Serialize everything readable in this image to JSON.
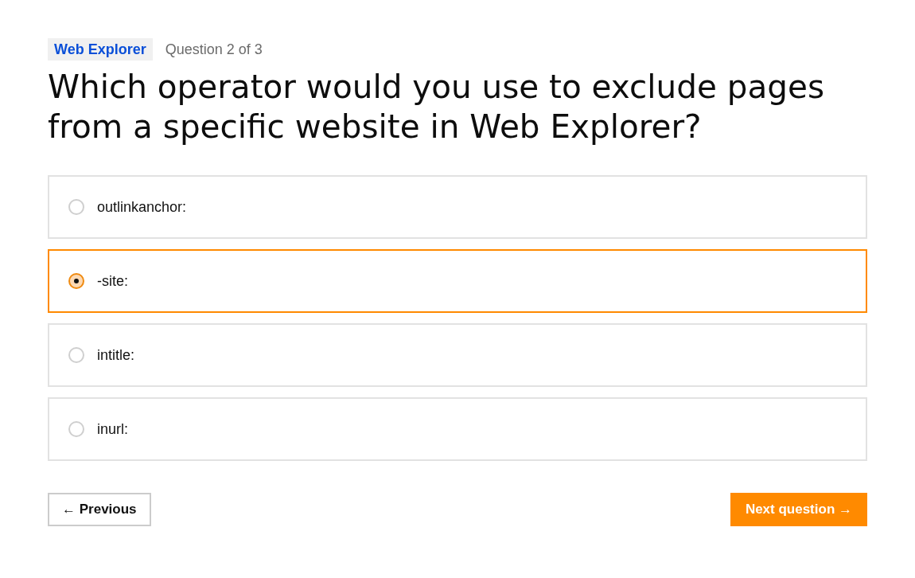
{
  "header": {
    "tag": "Web Explorer",
    "counter": "Question 2 of 3"
  },
  "question": "Which operator would you use to exclude pages from a specific website in Web Explorer?",
  "options": [
    {
      "label": "outlinkanchor:",
      "selected": false
    },
    {
      "label": "-site:",
      "selected": true
    },
    {
      "label": "intitle:",
      "selected": false
    },
    {
      "label": "inurl:",
      "selected": false
    }
  ],
  "buttons": [
    {
      "kind": "secondary",
      "label": "← Previous"
    },
    {
      "kind": "primary",
      "label": "Next question →"
    }
  ]
}
